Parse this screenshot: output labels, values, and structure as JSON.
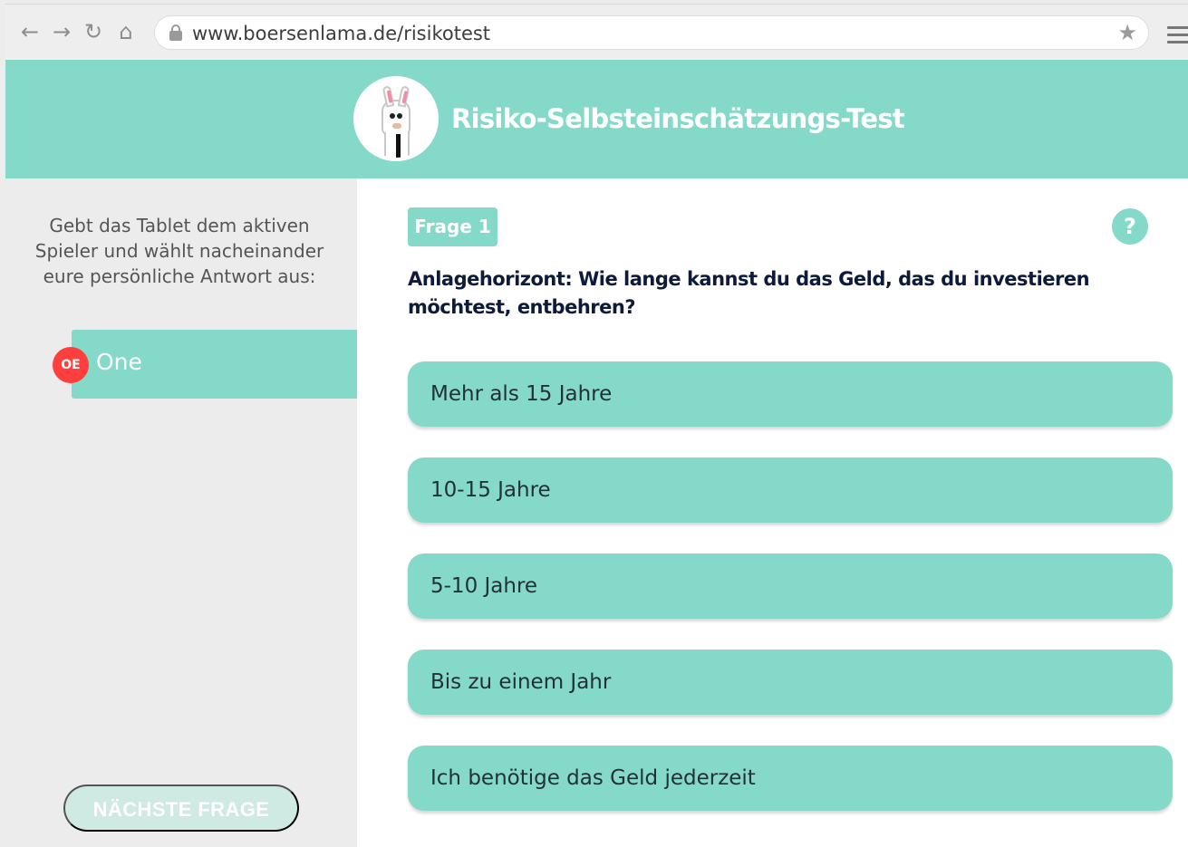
{
  "browser": {
    "back_icon": "arrow-left-icon",
    "forward_icon": "arrow-right-icon",
    "reload_icon": "reload-icon",
    "home_icon": "home-icon",
    "url": "www.boersenlama.de/risikotest",
    "lock_icon": "lock-icon",
    "bookmark_icon": "star-icon",
    "menu_icon": "hamburger-menu-icon"
  },
  "header": {
    "title": "Risiko-Selbsteinschätzungs-Test",
    "logo_icon": "llama-logo-icon",
    "background_color": "#84d9c8"
  },
  "sidebar": {
    "instruction": "Gebt das Tablet dem aktiven Spieler und wählt nacheinander eure persönliche Antwort aus:",
    "player": {
      "initials": "OE",
      "name": "One",
      "avatar_color": "#ff3e3e"
    },
    "next_button": "NÄCHSTE FRAGE"
  },
  "main": {
    "question_tag": "Frage 1",
    "help_label": "?",
    "question": "Anlagehorizont: Wie lange kannst du das Geld, das du investieren möchtest, entbehren?",
    "answers": [
      "Mehr als 15 Jahre",
      "10-15 Jahre",
      "5-10 Jahre",
      "Bis zu einem Jahr",
      "Ich benötige das Geld jederzeit"
    ]
  },
  "colors": {
    "accent": "#84d9c8",
    "sidebar_background": "#ececec",
    "main_background": "#ffffff",
    "question_text": "#0e1a3a"
  }
}
